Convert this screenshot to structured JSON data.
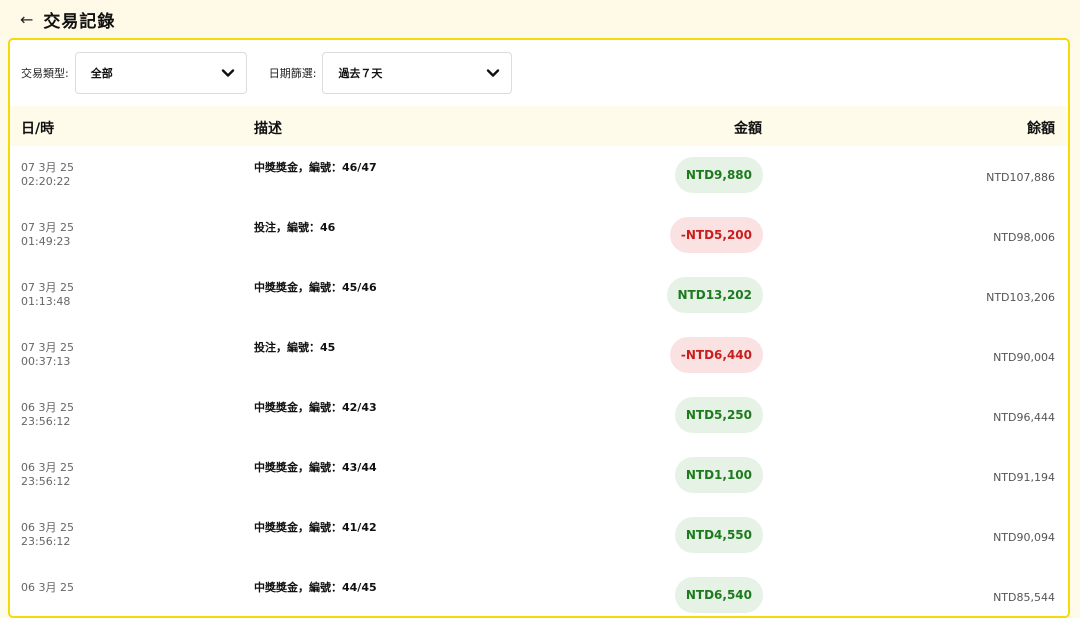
{
  "header": {
    "back_icon": "←",
    "title": "交易記錄"
  },
  "filters": {
    "type_label": "交易類型:",
    "type_value": "全部",
    "date_label": "日期篩選:",
    "date_value": "過去７天"
  },
  "table": {
    "columns": {
      "date": "日/時",
      "description": "描述",
      "amount": "金額",
      "balance": "餘額"
    },
    "rows": [
      {
        "date": "07 3月 25",
        "time": "02:20:22",
        "description": "中獎獎金，編號：46/47",
        "amount": "NTD9,880",
        "kind": "pos",
        "balance": "NTD107,886"
      },
      {
        "date": "07 3月 25",
        "time": "01:49:23",
        "description": "投注，編號：46",
        "amount": "-NTD5,200",
        "kind": "neg",
        "balance": "NTD98,006"
      },
      {
        "date": "07 3月 25",
        "time": "01:13:48",
        "description": "中獎獎金，編號：45/46",
        "amount": "NTD13,202",
        "kind": "pos",
        "balance": "NTD103,206"
      },
      {
        "date": "07 3月 25",
        "time": "00:37:13",
        "description": "投注，編號：45",
        "amount": "-NTD6,440",
        "kind": "neg",
        "balance": "NTD90,004"
      },
      {
        "date": "06 3月 25",
        "time": "23:56:12",
        "description": "中獎獎金，編號：42/43",
        "amount": "NTD5,250",
        "kind": "pos",
        "balance": "NTD96,444"
      },
      {
        "date": "06 3月 25",
        "time": "23:56:12",
        "description": "中獎獎金，編號：43/44",
        "amount": "NTD1,100",
        "kind": "pos",
        "balance": "NTD91,194"
      },
      {
        "date": "06 3月 25",
        "time": "23:56:12",
        "description": "中獎獎金，編號：41/42",
        "amount": "NTD4,550",
        "kind": "pos",
        "balance": "NTD90,094"
      },
      {
        "date": "06 3月 25",
        "time": "",
        "description": "中獎獎金，編號：44/45",
        "amount": "NTD6,540",
        "kind": "pos",
        "balance": "NTD85,544"
      }
    ]
  },
  "colors": {
    "accent_border": "#f5d90a",
    "positive": "#1e7a1e",
    "negative": "#c81e1e",
    "header_bg": "#fffae8"
  }
}
